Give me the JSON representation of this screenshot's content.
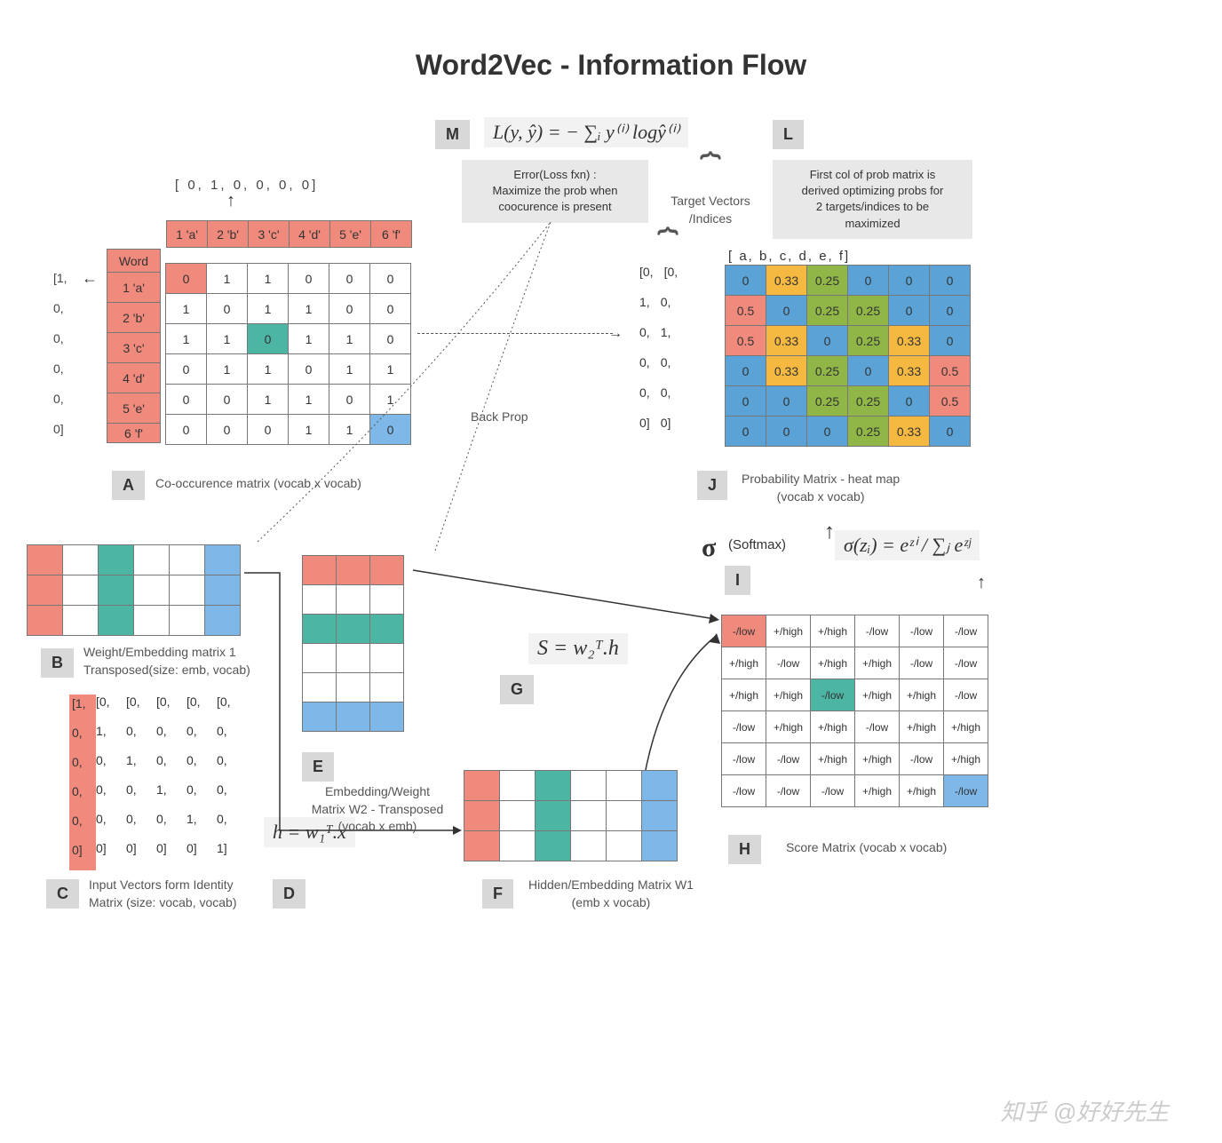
{
  "title": "Word2Vec - Information Flow",
  "watermark": "知乎 @好好先生",
  "backprop_label": "Back Prop",
  "loss_note": "Error(Loss fxn) :\nMaximize the prob when\ncoocurence is present",
  "target_label": "Target Vectors\n/Indices",
  "softmax_label": "(Softmax)",
  "formulas": {
    "loss": "L(y, ŷ) = − ∑ᵢ y⁽ⁱ⁾ logŷ⁽ⁱ⁾",
    "score": "S = w₂ᵀ.h",
    "hidden": "h = w₁ᵀ.x",
    "softmax": "σ(zᵢ) = eᶻⁱ / ∑ⱼ eᶻʲ"
  },
  "top_vector": "[ 0,   1,   0,   0,   0,   0]",
  "left_vector": [
    "[1,",
    "0,",
    "0,",
    "0,",
    "0,",
    "0]"
  ],
  "sections": {
    "A": {
      "tag": "A",
      "caption": "Co-occurence matrix (vocab x vocab)",
      "word_header": "Word",
      "row_labels": [
        "1 'a'",
        "2 'b'",
        "3 'c'",
        "4 'd'",
        "5 'e'",
        "6 'f'"
      ],
      "col_labels": [
        "1 'a'",
        "2 'b'",
        "3 'c'",
        "4 'd'",
        "5 'e'",
        "6 'f'"
      ],
      "matrix": [
        [
          0,
          1,
          1,
          0,
          0,
          0
        ],
        [
          1,
          0,
          1,
          1,
          0,
          0
        ],
        [
          1,
          1,
          0,
          1,
          1,
          0
        ],
        [
          0,
          1,
          1,
          0,
          1,
          1
        ],
        [
          0,
          0,
          1,
          1,
          0,
          1
        ],
        [
          0,
          0,
          0,
          1,
          1,
          0
        ]
      ]
    },
    "B": {
      "tag": "B",
      "caption": "Weight/Embedding matrix 1\nTransposed(size: emb, vocab)"
    },
    "C": {
      "tag": "C",
      "caption": "Input Vectors form Identity\nMatrix (size: vocab, vocab)",
      "matrix": [
        [
          "[1,",
          "[0,",
          "[0,",
          "[0,",
          "[0,",
          "[0,"
        ],
        [
          "0,",
          "1,",
          "0,",
          "0,",
          "0,",
          "0,"
        ],
        [
          "0,",
          "0,",
          "1,",
          "0,",
          "0,",
          "0,"
        ],
        [
          "0,",
          "0,",
          "0,",
          "1,",
          "0,",
          "0,"
        ],
        [
          "0,",
          "0,",
          "0,",
          "0,",
          "1,",
          "0,"
        ],
        [
          "0]",
          "0]",
          "0]",
          "0]",
          "0]",
          "1]"
        ]
      ]
    },
    "D": {
      "tag": "D"
    },
    "E": {
      "tag": "E",
      "caption": "Embedding/Weight\nMatrix W2 - Transposed\n(vocab x emb)"
    },
    "F": {
      "tag": "F",
      "caption": "Hidden/Embedding Matrix W1\n(emb x vocab)"
    },
    "G": {
      "tag": "G"
    },
    "H": {
      "tag": "H",
      "caption": "Score Matrix (vocab x vocab)",
      "cells": [
        [
          "-/low",
          "+/high",
          "+/high",
          "-/low",
          "-/low",
          "-/low"
        ],
        [
          "+/high",
          "-/low",
          "+/high",
          "+/high",
          "-/low",
          "-/low"
        ],
        [
          "+/high",
          "+/high",
          "-/low",
          "+/high",
          "+/high",
          "-/low"
        ],
        [
          "-/low",
          "+/high",
          "+/high",
          "-/low",
          "+/high",
          "+/high"
        ],
        [
          "-/low",
          "-/low",
          "+/high",
          "+/high",
          "-/low",
          "+/high"
        ],
        [
          "-/low",
          "-/low",
          "-/low",
          "+/high",
          "+/high",
          "-/low"
        ]
      ],
      "hl": [
        [
          0,
          0
        ],
        [
          2,
          2
        ],
        [
          5,
          5
        ]
      ]
    },
    "I": {
      "tag": "I"
    },
    "J": {
      "tag": "J",
      "caption": "Probability Matrix - heat map\n(vocab x vocab)",
      "col_labels": [
        "[ a,",
        "b,",
        "c,",
        "d,",
        "e,",
        "f]"
      ],
      "left_cols": [
        [
          "[0,",
          "1,",
          "0,",
          "0,",
          "0,",
          "0]"
        ],
        [
          "[0,",
          "0,",
          "1,",
          "0,",
          "0,",
          "0]"
        ]
      ],
      "matrix": [
        [
          0,
          0.33,
          0.25,
          0,
          0,
          0
        ],
        [
          0.5,
          0,
          0.25,
          0.25,
          0,
          0
        ],
        [
          0.5,
          0.33,
          0,
          0.25,
          0.33,
          0
        ],
        [
          0,
          0.33,
          0.25,
          0,
          0.33,
          0.5
        ],
        [
          0,
          0,
          0.25,
          0.25,
          0,
          0.5
        ],
        [
          0,
          0,
          0,
          0.25,
          0.33,
          0
        ]
      ]
    },
    "L": {
      "tag": "L",
      "caption": "First col of prob matrix is\nderived optimizing probs for\n2 targets/indices to be\nmaximized"
    },
    "M": {
      "tag": "M"
    }
  }
}
